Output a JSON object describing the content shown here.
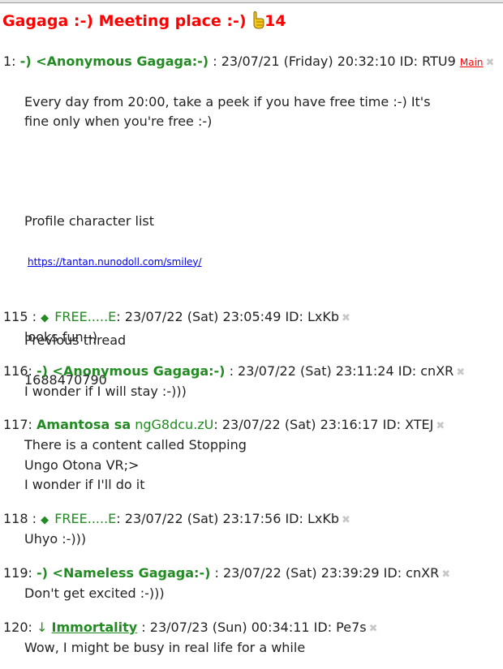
{
  "thread": {
    "title": "Gagaga :-) Meeting place :-) ",
    "number": "14"
  },
  "posts": [
    {
      "num": "1:",
      "name": "-) <Anonymous Gagaga:-)",
      "meta": " : 23/07/21 (Friday) 20:32:10 ID: RTU9",
      "main_label": "Main",
      "body_p1": "Every day from 20:00, take a peek if you have free time :-) It's\nfine only when you're free :-)",
      "profile_label": "Profile character list",
      "profile_url": "https://tantan.nunodoll.com/smiley/",
      "prev_label": "Previous thread",
      "prev_value": "1688470790"
    },
    {
      "num": "115 :",
      "trip": "FREE.....E",
      "meta": ": 23/07/22 (Sat) 23:05:49 ID: LxKb",
      "body": "looks fun:-)"
    },
    {
      "num": "116:",
      "name": "-) <Anonymous Gagaga:-)",
      "meta": " : 23/07/22 (Sat) 23:11:24 ID: cnXR",
      "body": "I wonder if I will stay :-)))"
    },
    {
      "num": "117:",
      "name": "Amantosa sa",
      "trip": "ngG8dcu.zU",
      "meta": ": 23/07/22 (Sat) 23:16:17 ID: XTEJ",
      "body": "There is a content called Stopping\nUngo Otona VR;>\nI wonder if I'll do it"
    },
    {
      "num": "118 :",
      "trip": "FREE.....E",
      "meta": ": 23/07/22 (Sat) 23:17:56 ID: LxKb",
      "body": "Uhyo :-)))"
    },
    {
      "num": "119:",
      "name": "-) <Nameless Gagaga:-)",
      "meta": " : 23/07/22 (Sat) 23:39:29 ID: cnXR",
      "body": "Don't get excited :-)))"
    },
    {
      "num": "120:",
      "arrow": "↓",
      "name": "Immortality",
      "meta": " : 23/07/23 (Sun) 00:34:11 ID: Pe7s",
      "body": "Wow, I might be busy in real life for a while"
    }
  ],
  "icons": {
    "hand": "pointing-hand-icon",
    "close": "close-icon",
    "diamond": "◆",
    "close_glyph": "✖"
  },
  "colors": {
    "title": "#ff0000",
    "name": "#228b22",
    "link": "#0000ee"
  }
}
